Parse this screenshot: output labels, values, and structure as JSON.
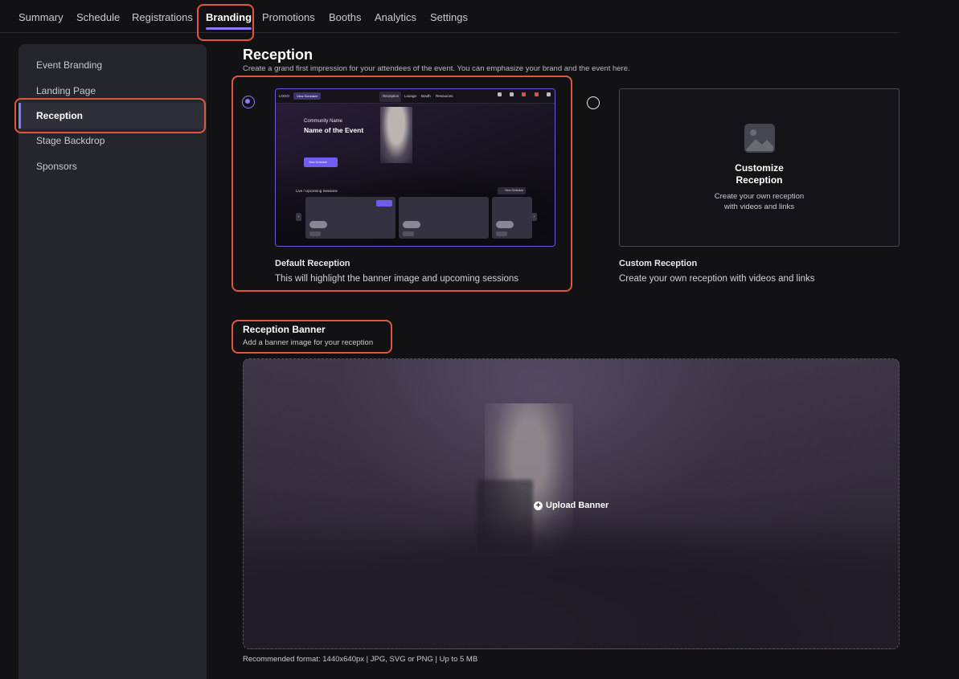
{
  "nav": {
    "tabs": [
      "Summary",
      "Schedule",
      "Registrations",
      "Branding",
      "Promotions",
      "Booths",
      "Analytics",
      "Settings"
    ]
  },
  "sidebar": {
    "items": [
      "Event Branding",
      "Landing Page",
      "Reception",
      "Stage Backdrop",
      "Sponsors"
    ]
  },
  "reception": {
    "title": "Reception",
    "subtitle": "Create a grand first impression for your attendees of the event. You can emphasize your brand and the event here."
  },
  "options": {
    "default_title": "Default Reception",
    "default_desc": "This will highlight the banner image and upcoming sessions",
    "custom_title": "Custom Reception",
    "custom_desc": "Create your own reception with videos and links",
    "custom_box_title_line1": "Customize",
    "custom_box_title_line2": "Reception",
    "custom_box_sub_line1": "Create your own reception",
    "custom_box_sub_line2": "with videos and links"
  },
  "preview": {
    "logo": "LOGO",
    "pill": "View Schedule",
    "tabs": [
      "Reception",
      "Lounge",
      "Booth",
      "Resources"
    ],
    "community_name": "Community Name",
    "event_name": "Name of the Event",
    "button": "View Schedule",
    "sessions_label": "Live / Upcoming Sessions",
    "view_schedule": "View Schedule"
  },
  "banner": {
    "title": "Reception Banner",
    "subtitle": "Add a banner image for your reception",
    "upload_label": "Upload Banner",
    "recommended": "Recommended format: 1440x640px | JPG, SVG or PNG | Up to 5 MB"
  }
}
